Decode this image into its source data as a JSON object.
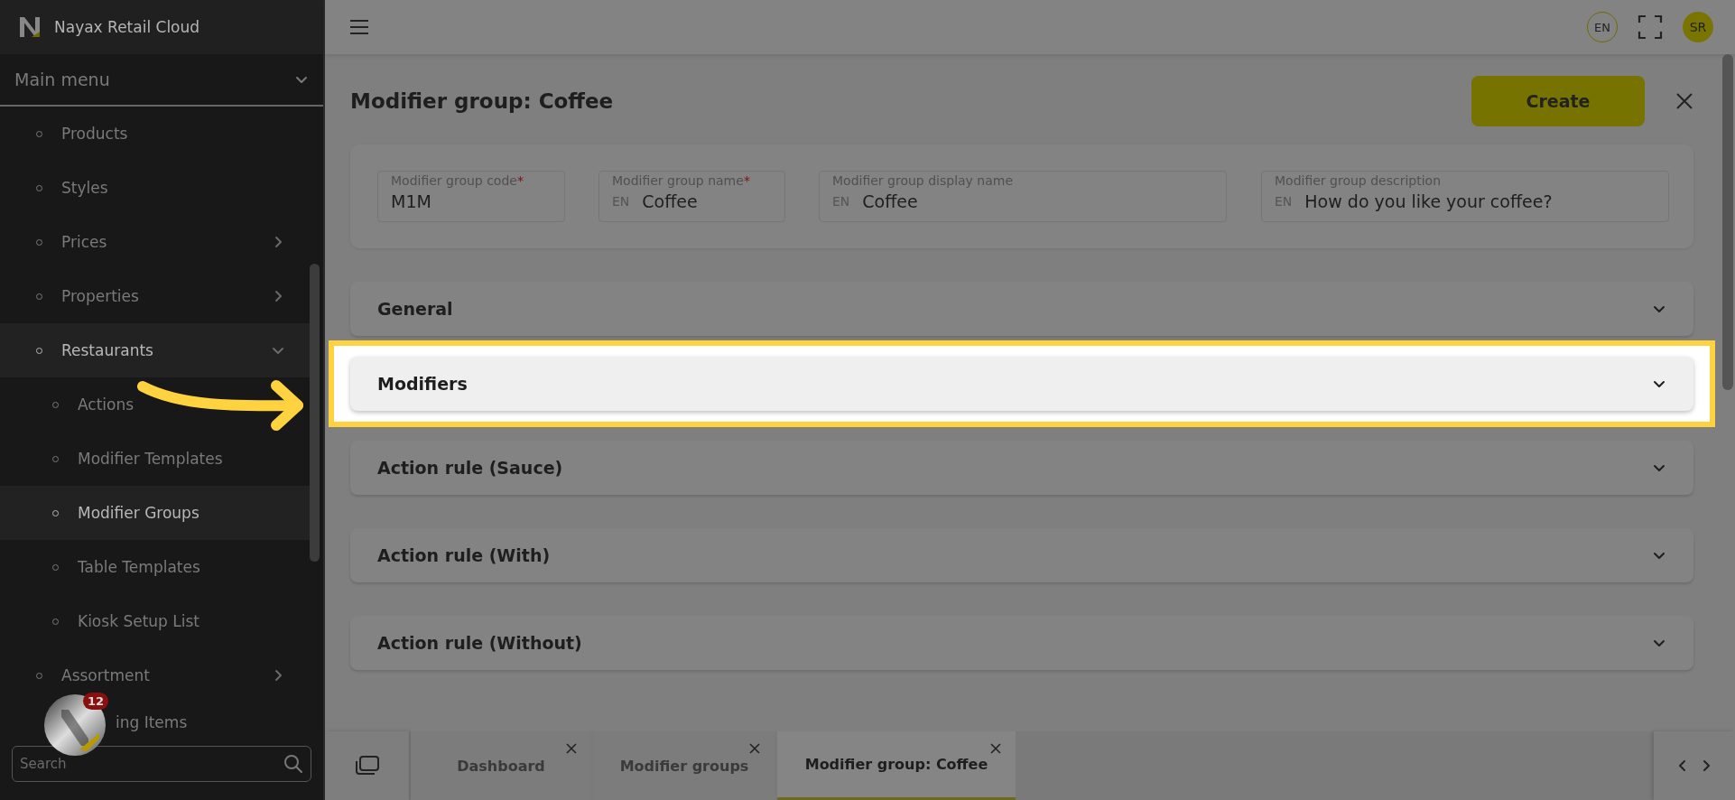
{
  "app": {
    "title": "Nayax Retail Cloud"
  },
  "sidebar": {
    "section": {
      "label": "Main menu",
      "expanded": true
    },
    "items": [
      {
        "label": "Products",
        "kind": "link",
        "selected": false
      },
      {
        "label": "Styles",
        "kind": "link",
        "selected": false
      },
      {
        "label": "Prices",
        "kind": "group",
        "expanded": false,
        "selected": false
      },
      {
        "label": "Properties",
        "kind": "group",
        "expanded": false,
        "selected": false
      },
      {
        "label": "Restaurants",
        "kind": "group",
        "expanded": true,
        "selected": true,
        "children": [
          {
            "label": "Actions",
            "selected": false
          },
          {
            "label": "Modifier Templates",
            "selected": false
          },
          {
            "label": "Modifier Groups",
            "selected": true
          },
          {
            "label": "Table Templates",
            "selected": false
          },
          {
            "label": "Kiosk Setup List",
            "selected": false
          }
        ]
      },
      {
        "label": "Assortment",
        "kind": "group",
        "expanded": false,
        "selected": false
      },
      {
        "label": "ing Items",
        "kind": "clipped",
        "selected": false
      }
    ],
    "search": {
      "placeholder": "Search"
    },
    "launcher": {
      "badge": "12"
    }
  },
  "topbar": {
    "language": "EN",
    "avatar": "SR"
  },
  "page": {
    "title": "Modifier group: Coffee",
    "create_button": "Create",
    "fields": [
      {
        "label": "Modifier group code",
        "required_mark": "*",
        "value": "M1M"
      },
      {
        "label": "Modifier group name",
        "required_mark": "*",
        "lang": "EN",
        "value": "Coffee"
      },
      {
        "label": "Modifier group display name",
        "lang": "EN",
        "value": "Coffee"
      },
      {
        "label": "Modifier group description",
        "lang": "EN",
        "value": "How do you like your coffee?"
      }
    ],
    "sections": [
      {
        "title": "General",
        "highlighted": false
      },
      {
        "title": "Modifiers",
        "highlighted": true
      },
      {
        "title": "Action rule (Sauce)",
        "highlighted": false
      },
      {
        "title": "Action rule (With)",
        "highlighted": false
      },
      {
        "title": "Action rule (Without)",
        "highlighted": false
      }
    ]
  },
  "tabs": [
    {
      "label": "Dashboard",
      "selected": false
    },
    {
      "label": "Modifier groups",
      "selected": false
    },
    {
      "label": "Modifier group: Coffee",
      "selected": true
    }
  ]
}
